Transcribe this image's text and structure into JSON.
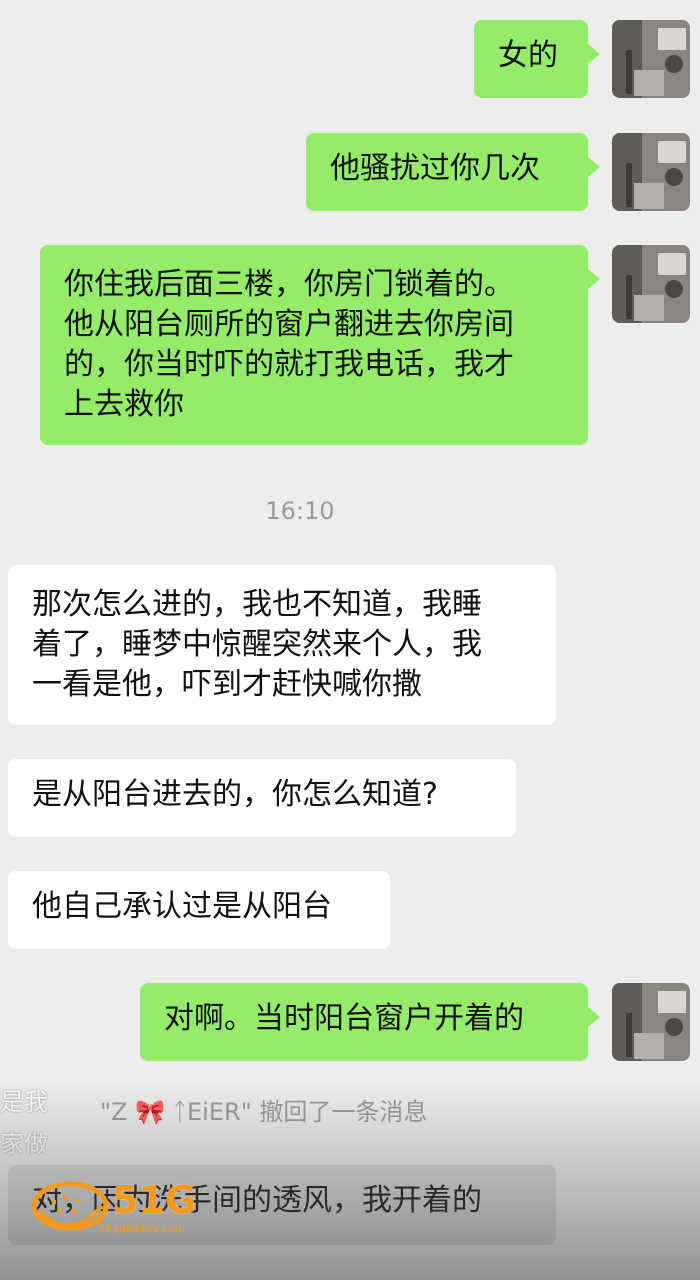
{
  "time_separator": "16:10",
  "messages": [
    {
      "side": "out",
      "text": "女的"
    },
    {
      "side": "out",
      "text": "他骚扰过你几次"
    },
    {
      "side": "out",
      "lines": [
        "你住我后面三楼，你房门锁着的。",
        "他从阳台厕所的窗户翻进去你房间",
        "的，你当时吓的就打我电话，我才",
        "上去救你"
      ]
    },
    {
      "side": "in",
      "lines": [
        "那次怎么进的，我也不知道，我睡",
        "着了，睡梦中惊醒突然来个人，我",
        "一看是他，吓到才赶快喊你撒"
      ]
    },
    {
      "side": "in",
      "text": "是从阳台进去的，你怎么知道?"
    },
    {
      "side": "in",
      "text": "他自己承认过是从阳台"
    },
    {
      "side": "out",
      "text": "对啊。当时阳台窗户开着的"
    },
    {
      "side": "in",
      "text": "对，因为洗手间的透风，我开着的"
    }
  ],
  "recall_notice": "\"Z 🎀 ᛏEiER\" 撤回了一条消息",
  "side_notes": [
    "是我",
    "家做"
  ],
  "watermark": {
    "text": "51G",
    "sub": "51gualianv.com",
    "color": "#f39a1e"
  },
  "colors": {
    "outgoing_bubble": "#95ec69",
    "incoming_bubble": "#ffffff",
    "background": "#ededed"
  }
}
